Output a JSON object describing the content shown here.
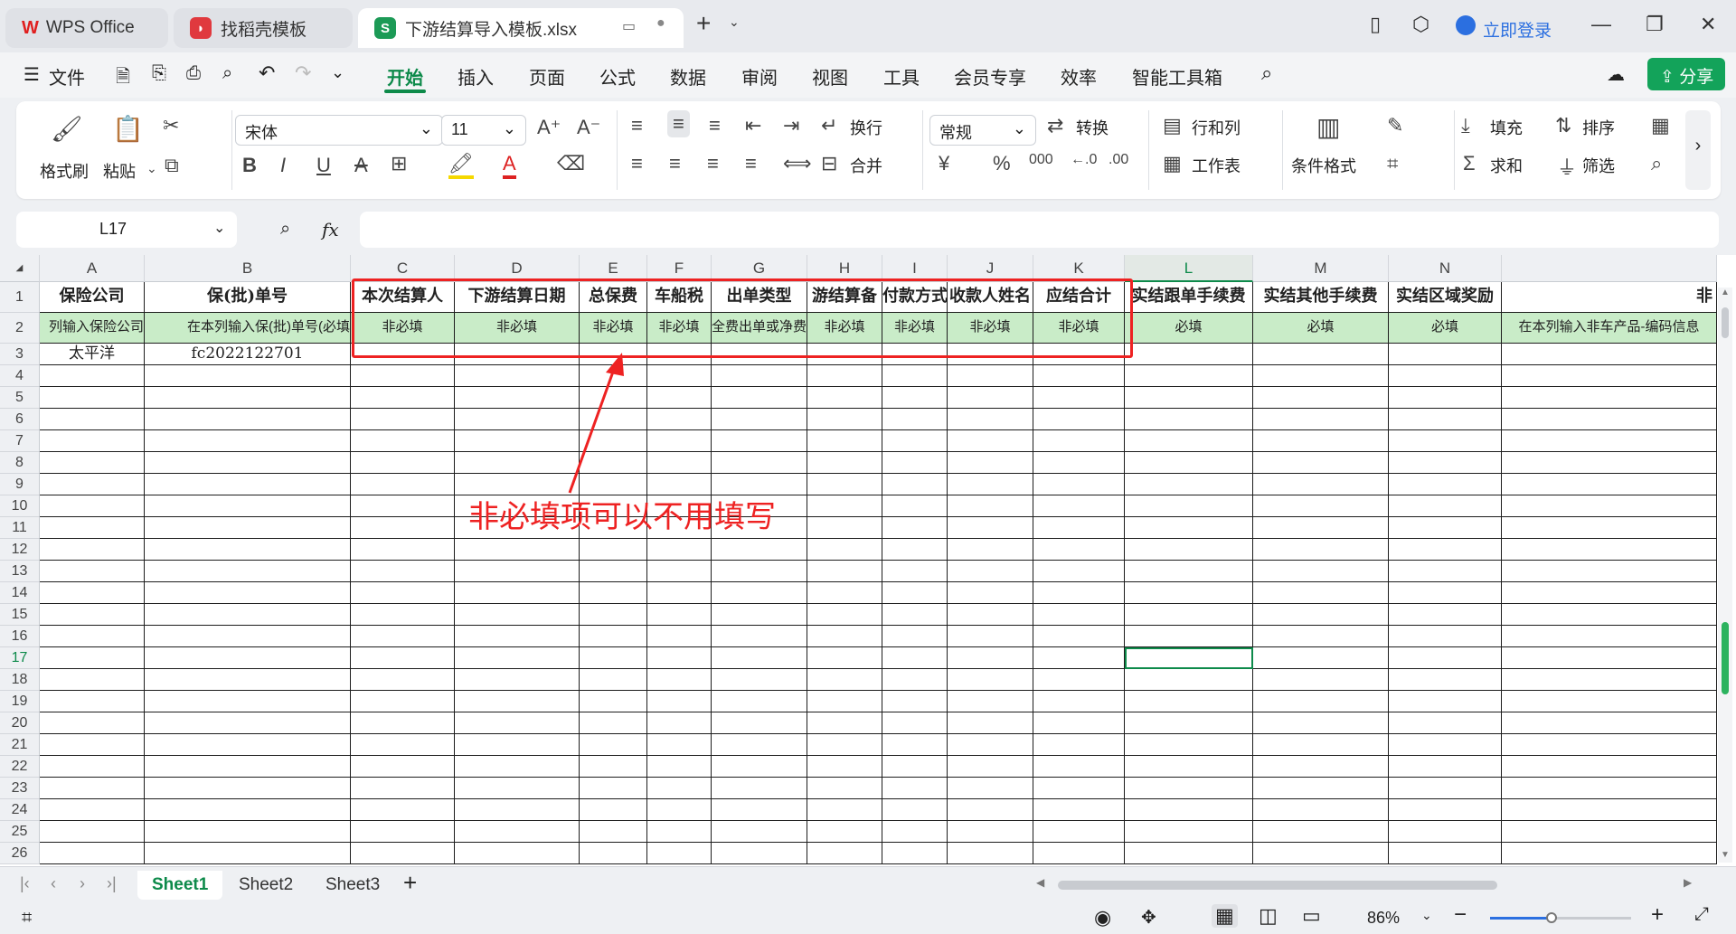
{
  "titlebar": {
    "tabs": [
      {
        "label": "WPS Office",
        "icon": "wps-logo-icon"
      },
      {
        "label": "找稻壳模板",
        "icon": "docer-icon"
      },
      {
        "label": "下游结算导入模板.xlsx",
        "icon": "spreadsheet-icon"
      }
    ],
    "login_label": "立即登录"
  },
  "menubar": {
    "file_label": "文件",
    "items": [
      "开始",
      "插入",
      "页面",
      "公式",
      "数据",
      "审阅",
      "视图",
      "工具",
      "会员专享",
      "效率",
      "智能工具箱"
    ],
    "active": "开始",
    "share_label": "分享"
  },
  "ribbon": {
    "format_painter": "格式刷",
    "paste": "粘贴",
    "font_name": "宋体",
    "font_size": "11",
    "wrap": "换行",
    "merge": "合并",
    "number_format": "常规",
    "convert": "转换",
    "rows_cols": "行和列",
    "worksheet": "工作表",
    "cond_format": "条件格式",
    "fill": "填充",
    "sort": "排序",
    "sum": "求和",
    "filter": "筛选"
  },
  "formula": {
    "cell_ref": "L17",
    "fx": "fx",
    "value": ""
  },
  "columns": [
    "A",
    "B",
    "C",
    "D",
    "E",
    "F",
    "G",
    "H",
    "I",
    "J",
    "K",
    "L",
    "M",
    "N"
  ],
  "selected_column": "L",
  "row1": [
    "保险公司",
    "保(批)单号",
    "本次结算人",
    "下游结算日期",
    "总保费",
    "车船税",
    "出单类型",
    "游结算备",
    "付款方式",
    "收款人姓名",
    "应结合计",
    "实结跟单手续费",
    "实结其他手续费",
    "实结区域奖励",
    "非"
  ],
  "row2": [
    "列输入保险公司",
    "在本列输入保(批)单号(必填",
    "非必填",
    "非必填",
    "非必填",
    "非必填",
    "全费出单或净费",
    "非必填",
    "非必填",
    "非必填",
    "非必填",
    "必填",
    "必填",
    "必填",
    "在本列输入非车产品-编码信息"
  ],
  "row3": [
    "太平洋",
    "fc2022122701"
  ],
  "row_numbers": [
    "1",
    "2",
    "3",
    "4",
    "5",
    "6",
    "7",
    "8",
    "9",
    "10",
    "11",
    "12",
    "13",
    "14",
    "15",
    "16",
    "17",
    "18",
    "19",
    "20",
    "21",
    "22",
    "23",
    "24",
    "25",
    "26"
  ],
  "selected_row": "17",
  "annotation": "非必填项可以不用填写",
  "sheets": [
    "Sheet1",
    "Sheet2",
    "Sheet3"
  ],
  "active_sheet": "Sheet1",
  "zoom": "86%",
  "colors": {
    "accent": "#0d8a4a",
    "annotation": "#ee2222",
    "row2_fill": "#c9ecc8"
  }
}
